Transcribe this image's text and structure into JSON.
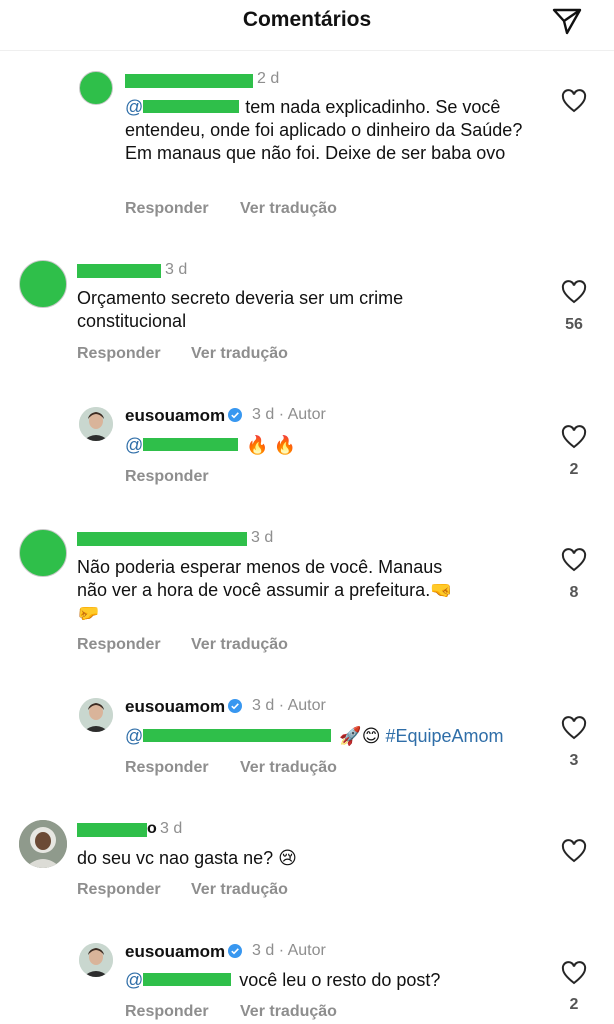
{
  "header": {
    "title": "Comentários",
    "share_icon": "paper-plane-icon"
  },
  "comments": [
    {
      "time": "2 d",
      "text": "tem nada explicadinho. Se você entendeu, onde foi aplicado o dinheiro da Saúde? Em manaus que não foi. Deixe de ser baba ovo",
      "mention_prefix": "@",
      "reply": "Responder",
      "translate": "Ver tradução",
      "likes": ""
    },
    {
      "time": "3 d",
      "text": "Orçamento secreto deveria ser um crime constitucional",
      "reply": "Responder",
      "translate": "Ver tradução",
      "likes": "56"
    },
    {
      "username": "eusouamom",
      "time": "3 d · Autor",
      "mention_prefix": "@",
      "emoji": "🔥 🔥",
      "reply": "Responder",
      "likes": "2"
    },
    {
      "time": "3 d",
      "text_line1": "Não poderia esperar menos de você. Manaus",
      "text_line2": "não ver a hora de você assumir a prefeitura.🤜",
      "text_line3": "🤛",
      "reply": "Responder",
      "translate": "Ver tradução",
      "likes": "8"
    },
    {
      "username": "eusouamom",
      "time": "3 d · Autor",
      "mention_prefix": "@",
      "emoji": "🚀😊",
      "hashtag": "#EquipeAmom",
      "reply": "Responder",
      "translate": "Ver tradução",
      "likes": "3"
    },
    {
      "time": "3 d",
      "name_suffix": "o",
      "text": "do seu vc nao gasta ne? 😢",
      "reply": "Responder",
      "translate": "Ver tradução",
      "likes": ""
    },
    {
      "username": "eusouamom",
      "time": "3 d · Autor",
      "mention_prefix": "@",
      "text": "você leu o resto do post?",
      "reply": "Responder",
      "translate": "Ver tradução",
      "likes": "2"
    }
  ],
  "colors": {
    "redaction": "#2fbf4a",
    "mention": "#2f6ea8",
    "muted": "#8e8e8e",
    "verified": "#3897f0"
  }
}
